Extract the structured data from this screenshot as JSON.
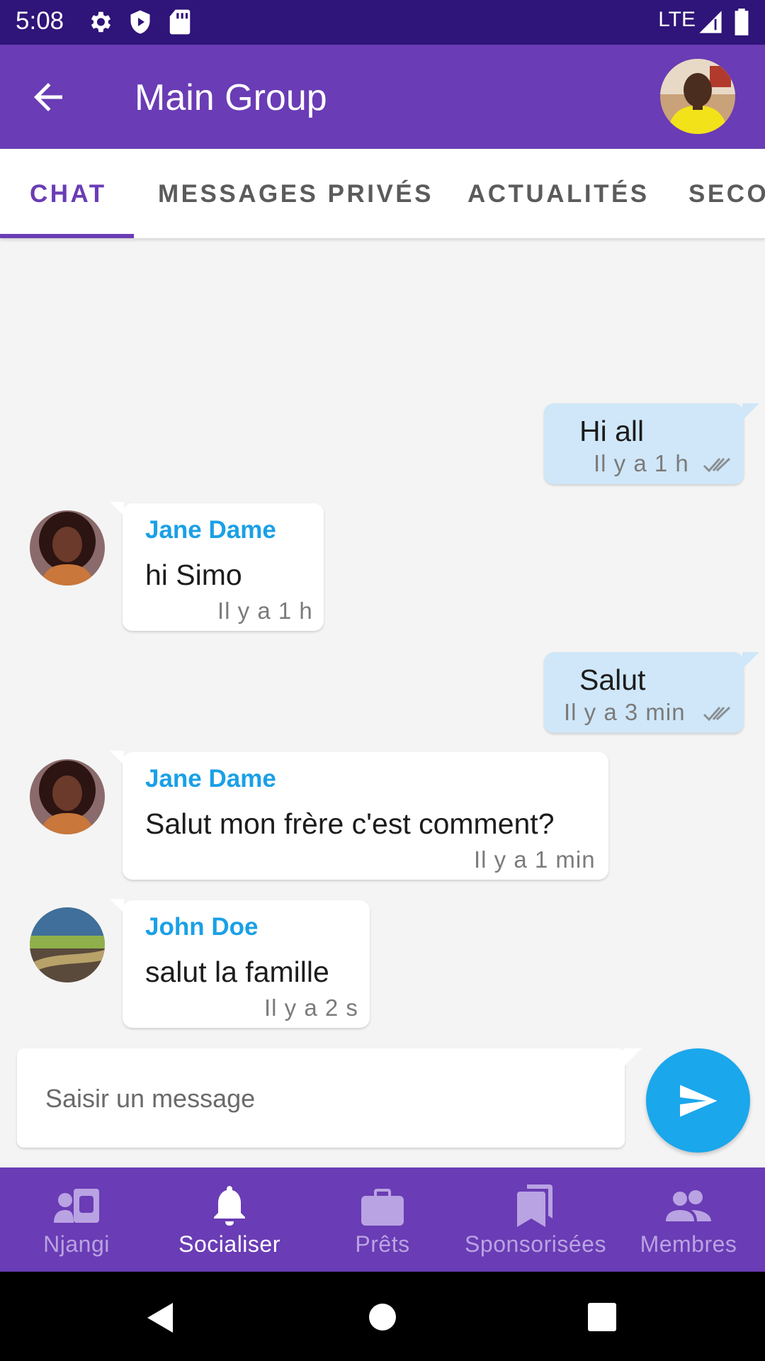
{
  "status_bar": {
    "time": "5:08",
    "network": "LTE",
    "icons": [
      "gear-icon",
      "play-protect-icon",
      "sd-card-icon",
      "signal-icon",
      "battery-icon"
    ]
  },
  "app_bar": {
    "title": "Main Group",
    "back_icon": "arrow-back-icon",
    "avatar": "group-avatar"
  },
  "tabs": [
    {
      "label": "CHAT",
      "active": true
    },
    {
      "label": "MESSAGES PRIVÉS",
      "active": false
    },
    {
      "label": "ACTUALITÉS",
      "active": false
    },
    {
      "label": "SECO",
      "active": false
    }
  ],
  "messages": [
    {
      "direction": "out",
      "text": "Hi all",
      "time": "Il y a 1 h",
      "read": true
    },
    {
      "direction": "in",
      "sender": "Jane Dame",
      "text": "hi Simo",
      "time": "Il y a 1 h"
    },
    {
      "direction": "out",
      "text": "Salut",
      "time": "Il y a 3 min",
      "read": true
    },
    {
      "direction": "in",
      "sender": "Jane Dame",
      "text": "Salut mon frère c'est comment?",
      "time": "Il y a 1 min"
    },
    {
      "direction": "in",
      "sender": "John Doe",
      "text": "salut la famille",
      "time": "Il y a 2 s"
    }
  ],
  "composer": {
    "placeholder": "Saisir un message",
    "send_icon": "send-icon"
  },
  "bottom_nav": [
    {
      "label": "Njangi",
      "icon": "id-card-icon",
      "active": false
    },
    {
      "label": "Socialiser",
      "icon": "bell-icon",
      "active": true
    },
    {
      "label": "Prêts",
      "icon": "briefcase-icon",
      "active": false
    },
    {
      "label": "Sponsorisées",
      "icon": "bookmarks-icon",
      "active": false
    },
    {
      "label": "Membres",
      "icon": "people-icon",
      "active": false
    }
  ],
  "colors": {
    "status_bar": "#2f1479",
    "primary": "#6a3cb5",
    "accent": "#1aa7ec",
    "sender_name": "#1aa0e6",
    "outgoing_bubble": "#cfe7f8"
  }
}
